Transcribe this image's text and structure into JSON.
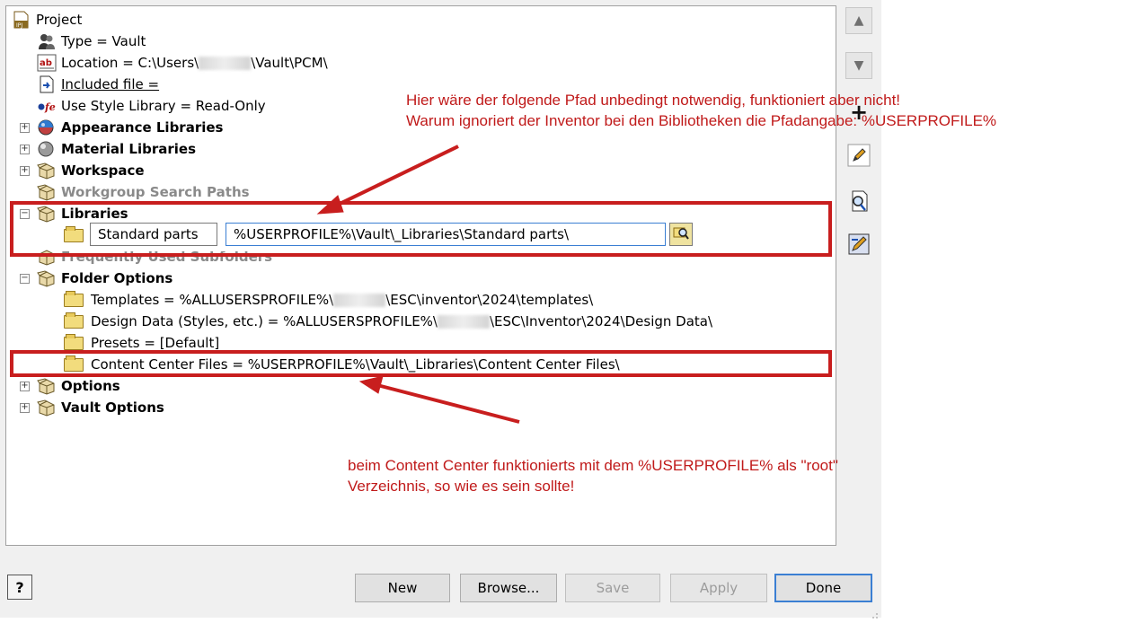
{
  "tree": {
    "project": "Project",
    "type": "Type = Vault",
    "location_prefix": "Location = C:\\Users\\",
    "location_suffix": "\\Vault\\PCM\\",
    "included_file": "Included file = ",
    "use_style_library": "Use Style Library = Read-Only",
    "appearance_libraries": "Appearance Libraries",
    "material_libraries": "Material Libraries",
    "workspace": "Workspace",
    "workgroup_search_paths": "Workgroup Search Paths",
    "libraries": "Libraries",
    "library_name_value": "Standard parts",
    "library_path_value": "%USERPROFILE%\\Vault\\_Libraries\\Standard parts\\",
    "frequently_used_subfolders": "Frequently Used Subfolders",
    "folder_options": "Folder Options",
    "templates_prefix": "Templates = %ALLUSERSPROFILE%\\",
    "templates_suffix": "\\ESC\\inventor\\2024\\templates\\",
    "design_data_prefix": "Design Data (Styles, etc.) = %ALLUSERSPROFILE%\\",
    "design_data_suffix": "\\ESC\\Inventor\\2024\\Design Data\\",
    "presets": "Presets = [Default]",
    "content_center_files": "Content Center Files = %USERPROFILE%\\Vault\\_Libraries\\Content Center Files\\",
    "options": "Options",
    "vault_options": "Vault Options",
    "expand_plus": "+",
    "expand_minus": "−"
  },
  "side_toolbar": {
    "move_up_glyph": "▲",
    "move_down_glyph": "▼",
    "add_glyph": "+"
  },
  "buttons": {
    "new": "New",
    "browse": "Browse...",
    "save": "Save",
    "apply": "Apply",
    "done": "Done",
    "help": "?"
  },
  "annotations": {
    "top_line1": "Hier wäre der folgende Pfad unbedingt notwendig, funktioniert aber nicht!",
    "top_line2": "Warum ignoriert der Inventor bei den Bibliotheken die Pfadangabe: %USERPROFILE%",
    "bottom_line1": "beim Content Center funktionierts mit dem %USERPROFILE% als \"root\"",
    "bottom_line2": "Verzeichnis, so wie es sein sollte!"
  },
  "colors": {
    "annotation_red": "#c81e1e",
    "dialog_bg": "#f0f0f0",
    "default_button_border": "#3b7fd3"
  },
  "icons": {
    "project": "ipj-file-icon",
    "type": "vault-people-icon",
    "location": "ab-text-icon",
    "included": "linked-file-icon",
    "style_library": "style-library-icon",
    "appearance": "appearance-sphere-icon",
    "material": "material-sphere-icon",
    "box": "open-box-icon",
    "folder": "folder-icon",
    "browse_path": "magnifier-folder-icon"
  }
}
